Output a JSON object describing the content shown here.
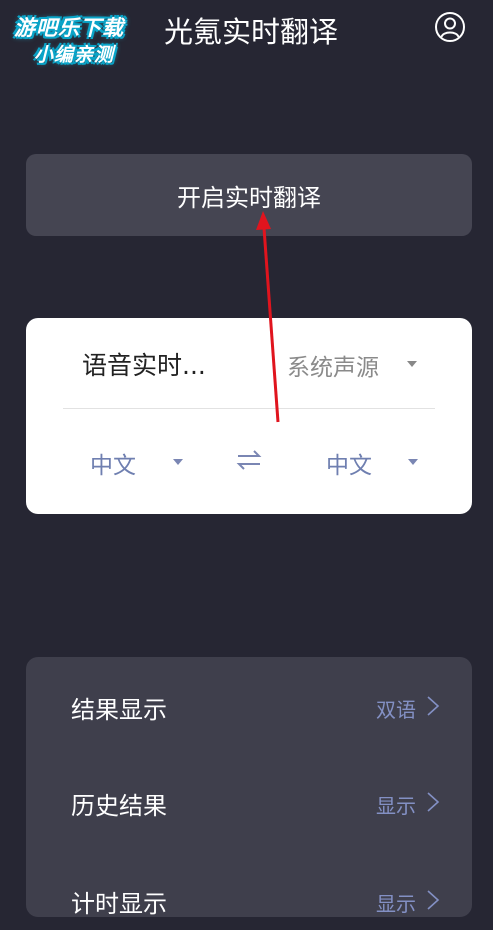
{
  "watermark": {
    "line1": "游吧乐下载",
    "line2": "小编亲测"
  },
  "header": {
    "title": "光氪实时翻译"
  },
  "start_button": {
    "label": "开启实时翻译"
  },
  "translate_card": {
    "mode": "语音实时...",
    "audio_source": "系统声源",
    "source_lang": "中文",
    "target_lang": "中文"
  },
  "settings": {
    "rows": [
      {
        "label": "结果显示",
        "value": "双语"
      },
      {
        "label": "历史结果",
        "value": "显示"
      },
      {
        "label": "计时显示",
        "value": "显示"
      }
    ]
  },
  "colors": {
    "background": "#262633",
    "panel": "#454552",
    "accent_text": "#8390c4",
    "annotation_arrow": "#e0141e"
  }
}
